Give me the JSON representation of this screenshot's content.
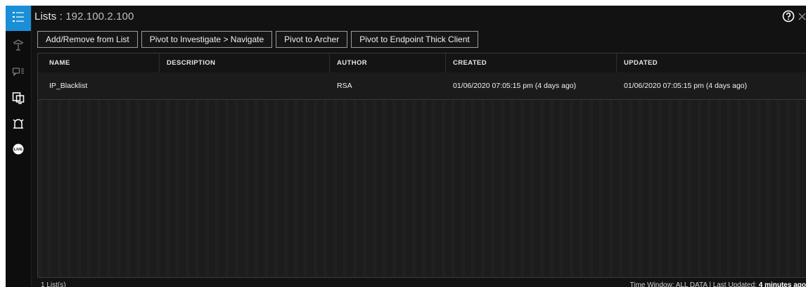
{
  "title": {
    "prefix": "Lists",
    "separator": ":",
    "host": "192.100.2.100"
  },
  "header_icons": [
    "help-icon",
    "close-icon"
  ],
  "sidebar": {
    "items": [
      {
        "icon": "list-icon",
        "active": true
      },
      {
        "icon": "pivot-icon",
        "active": false
      },
      {
        "icon": "chat-list-icon",
        "active": false
      },
      {
        "icon": "screens-icon",
        "active": false
      },
      {
        "icon": "alarm-icon",
        "active": false
      },
      {
        "icon": "live-icon",
        "active": false,
        "glyph_text": "LIVE"
      }
    ]
  },
  "toolbar": {
    "buttons": [
      "Add/Remove from List",
      "Pivot to Investigate > Navigate",
      "Pivot to Archer",
      "Pivot to Endpoint Thick Client"
    ]
  },
  "table": {
    "columns": [
      "NAME",
      "DESCRIPTION",
      "AUTHOR",
      "CREATED",
      "UPDATED"
    ],
    "rows": [
      {
        "name": "IP_Blacklist",
        "description": "",
        "author": "RSA",
        "created": "01/06/2020 07:05:15 pm (4 days ago)",
        "updated": "01/06/2020 07:05:15 pm (4 days ago)"
      }
    ]
  },
  "footer": {
    "count": "1 List(s)",
    "time_window_label": "Time Window: ALL DATA | Last Updated:",
    "last_updated_value": "4 minutes ago"
  },
  "colors": {
    "accent": "#1a8fd8",
    "background": "#121212",
    "grid_bg": "#1c1c1c"
  }
}
